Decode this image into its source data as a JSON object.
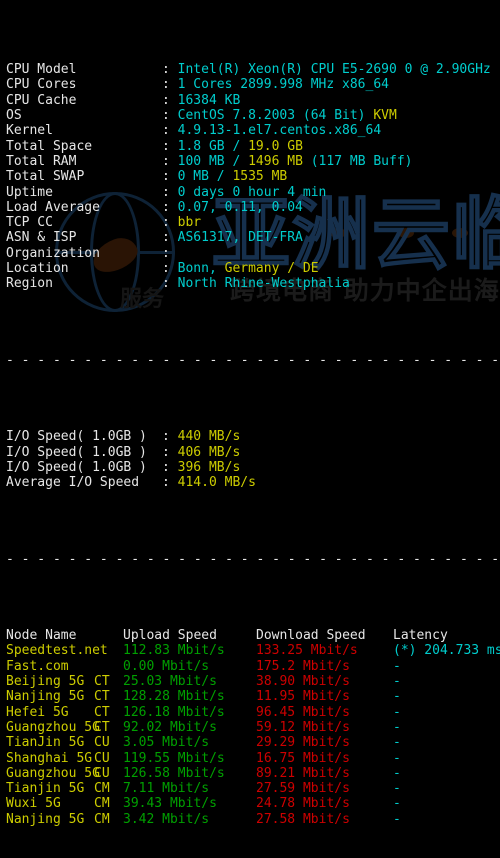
{
  "terminal": {
    "separator": "- - - - - - - - - - - - - - - - - - - - - - - - - - - - - - - - - - - - - - - - - - - - - - - - -",
    "colon": ":",
    "sysinfo": [
      {
        "label": "CPU Model",
        "value": "Intel(R) Xeon(R) CPU E5-2690 0 @ 2.90GHz"
      },
      {
        "label": "CPU Cores",
        "value": "1 Cores 2899.998 MHz x86_64"
      },
      {
        "label": "CPU Cache",
        "value": "16384 KB"
      },
      {
        "label": "OS",
        "value": "CentOS 7.8.2003 (64 Bit)",
        "value2": "KVM"
      },
      {
        "label": "Kernel",
        "value": "4.9.13-1.el7.centos.x86_64"
      },
      {
        "label": "Total Space",
        "value": "1.8 GB /",
        "value2": "19.0 GB"
      },
      {
        "label": "Total RAM",
        "value": "100 MB /",
        "value2": "1496 MB",
        "value3": "(117 MB Buff)"
      },
      {
        "label": "Total SWAP",
        "value": "0 MB /",
        "value2": "1535 MB"
      },
      {
        "label": "Uptime",
        "value": "0 days 0 hour 4 min"
      },
      {
        "label": "Load Average",
        "value": "0.07, 0.11, 0.04"
      },
      {
        "label": "TCP CC",
        "value2": "bbr"
      },
      {
        "label": "ASN & ISP",
        "value": "AS61317, DET-FRA"
      },
      {
        "label": "Organization",
        "value": ""
      },
      {
        "label": "Location",
        "value": "Bonn,",
        "value2": "Germany / DE"
      },
      {
        "label": "Region",
        "value": "North Rhine-Westphalia"
      }
    ],
    "iospeed": [
      {
        "label": "I/O Speed( 1.0GB )",
        "value": "440 MB/s"
      },
      {
        "label": "I/O Speed( 1.0GB )",
        "value": "406 MB/s"
      },
      {
        "label": "I/O Speed( 1.0GB )",
        "value": "396 MB/s"
      },
      {
        "label": "Average I/O Speed",
        "value": "414.0 MB/s"
      }
    ],
    "table": {
      "headers": {
        "node": "Node Name",
        "upload": "Upload Speed",
        "download": "Download Speed",
        "latency": "Latency"
      },
      "rows": [
        {
          "node": "Speedtest.net",
          "isp": "",
          "upload": "112.83 Mbit/s",
          "download": "133.25 Mbit/s",
          "latency": "(*) 204.733 ms"
        },
        {
          "node": "Fast.com",
          "isp": "",
          "upload": "0.00 Mbit/s",
          "download": "175.2 Mbit/s",
          "latency": "-"
        },
        {
          "node": "Beijing 5G",
          "isp": "CT",
          "upload": "25.03 Mbit/s",
          "download": "38.90 Mbit/s",
          "latency": "-"
        },
        {
          "node": "Nanjing 5G",
          "isp": "CT",
          "upload": "128.28 Mbit/s",
          "download": "11.95 Mbit/s",
          "latency": "-"
        },
        {
          "node": "Hefei 5G",
          "isp": "CT",
          "upload": "126.18 Mbit/s",
          "download": "96.45 Mbit/s",
          "latency": "-"
        },
        {
          "node": "Guangzhou 5G",
          "isp": "CT",
          "upload": "92.02 Mbit/s",
          "download": "59.12 Mbit/s",
          "latency": "-"
        },
        {
          "node": "TianJin 5G",
          "isp": "CU",
          "upload": "3.05 Mbit/s",
          "download": "29.29 Mbit/s",
          "latency": "-"
        },
        {
          "node": "Shanghai 5G",
          "isp": "CU",
          "upload": "119.55 Mbit/s",
          "download": "16.75 Mbit/s",
          "latency": "-"
        },
        {
          "node": "Guangzhou 5G",
          "isp": "CU",
          "upload": "126.58 Mbit/s",
          "download": "89.21 Mbit/s",
          "latency": "-"
        },
        {
          "node": "Tianjin 5G",
          "isp": "CM",
          "upload": "7.11 Mbit/s",
          "download": "27.59 Mbit/s",
          "latency": "-"
        },
        {
          "node": "Wuxi 5G",
          "isp": "CM",
          "upload": "39.43 Mbit/s",
          "download": "24.78 Mbit/s",
          "latency": "-"
        },
        {
          "node": "Nanjing 5G",
          "isp": "CM",
          "upload": "3.42 Mbit/s",
          "download": "27.58 Mbit/s",
          "latency": "-"
        }
      ]
    }
  },
  "watermark": {
    "main": "亚洲云临境探",
    "tagline": "跨境电商 助力中企出海",
    "prefix": "服务"
  },
  "colors": {
    "background": "#000000",
    "label": "#e6e6e6",
    "cyan": "#00cdcd",
    "yellow": "#cdcd00",
    "green": "#00a000",
    "red": "#cd0000"
  }
}
